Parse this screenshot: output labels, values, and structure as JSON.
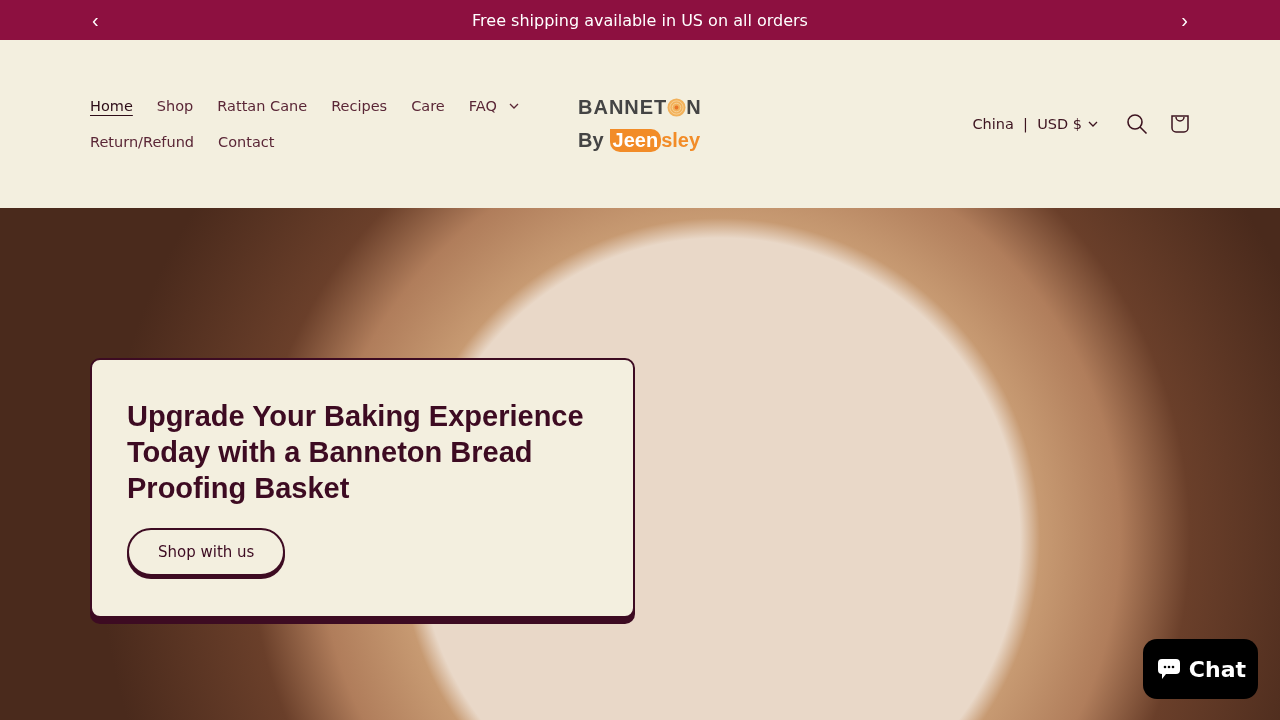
{
  "announcement": {
    "text": "Free shipping available in US on all orders",
    "prev": "‹",
    "next": "›"
  },
  "nav": [
    {
      "label": "Home",
      "selected": true,
      "kind": "link"
    },
    {
      "label": "Shop",
      "selected": false,
      "kind": "link"
    },
    {
      "label": "Rattan Cane",
      "selected": false,
      "kind": "link"
    },
    {
      "label": "Recipes",
      "selected": false,
      "kind": "link"
    },
    {
      "label": "Care",
      "selected": false,
      "kind": "link"
    },
    {
      "label": "FAQ",
      "selected": false,
      "kind": "dropdown"
    },
    {
      "label": "Return/Refund",
      "selected": false,
      "kind": "link"
    },
    {
      "label": "Contact",
      "selected": false,
      "kind": "link"
    }
  ],
  "logo": {
    "line1_start": "BANNET",
    "line1_end": "N",
    "line2_prefix": "By",
    "line2_highlight": "Jeen",
    "line2_rest": "sley"
  },
  "localization": {
    "country": "China",
    "separator": "|",
    "currency": "USD $"
  },
  "hero": {
    "heading": "Upgrade Your Baking Experience Today with a Banneton Bread Proofing Basket",
    "button": "Shop with us"
  },
  "chat": {
    "label": "Chat"
  }
}
